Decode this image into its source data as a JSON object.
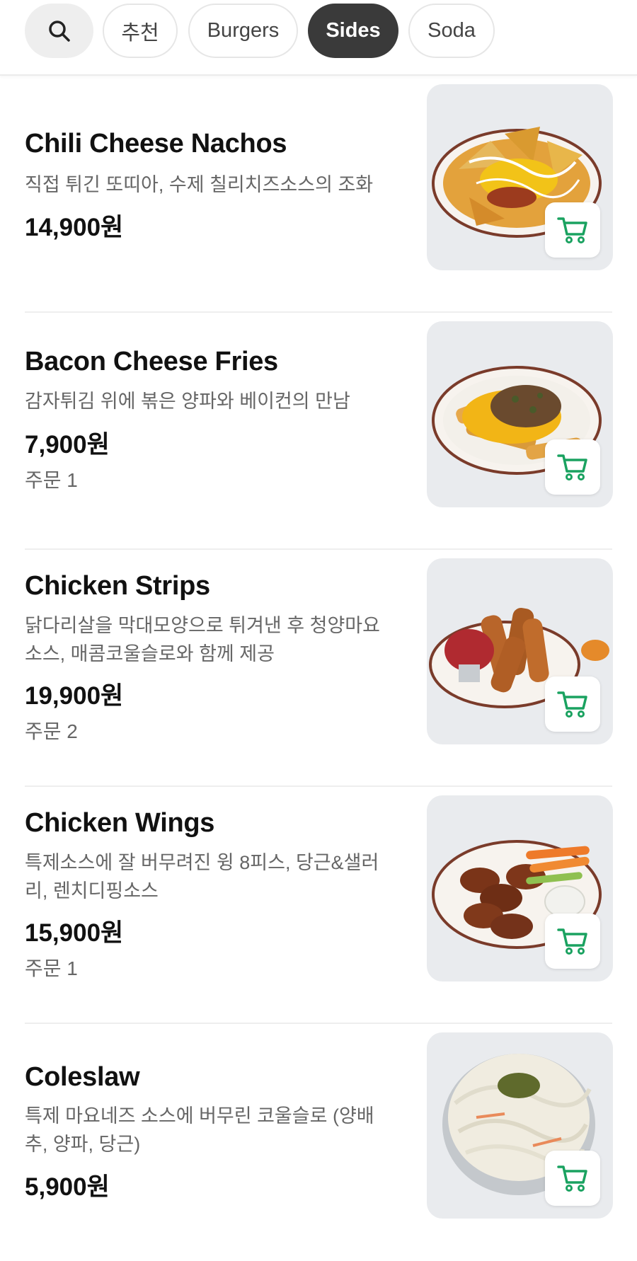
{
  "tabs": [
    {
      "label": "추천",
      "active": false
    },
    {
      "label": "Burgers",
      "active": false
    },
    {
      "label": "Sides",
      "active": true
    },
    {
      "label": "Soda",
      "active": false
    }
  ],
  "accent_color": "#1aa260",
  "items": [
    {
      "name": "Chili Cheese Nachos",
      "description": "직접 튀긴 또띠아, 수제 칠리치즈소스의 조화",
      "price": "14,900원",
      "orders": ""
    },
    {
      "name": "Bacon Cheese Fries",
      "description": "감자튀김 위에 볶은 양파와 베이컨의 만남",
      "price": "7,900원",
      "orders": "주문 1"
    },
    {
      "name": "Chicken Strips",
      "description": "닭다리살을 막대모양으로 튀겨낸 후 청양마요소스, 매콤코울슬로와 함께 제공",
      "price": "19,900원",
      "orders": "주문 2"
    },
    {
      "name": "Chicken Wings",
      "description": "특제소스에 잘 버무려진 윙 8피스, 당근&샐러리, 렌치디핑소스",
      "price": "15,900원",
      "orders": "주문 1"
    },
    {
      "name": "Coleslaw",
      "description": "특제 마요네즈 소스에 버무린 코울슬로 (양배추, 양파, 당근)",
      "price": "5,900원",
      "orders": ""
    }
  ]
}
